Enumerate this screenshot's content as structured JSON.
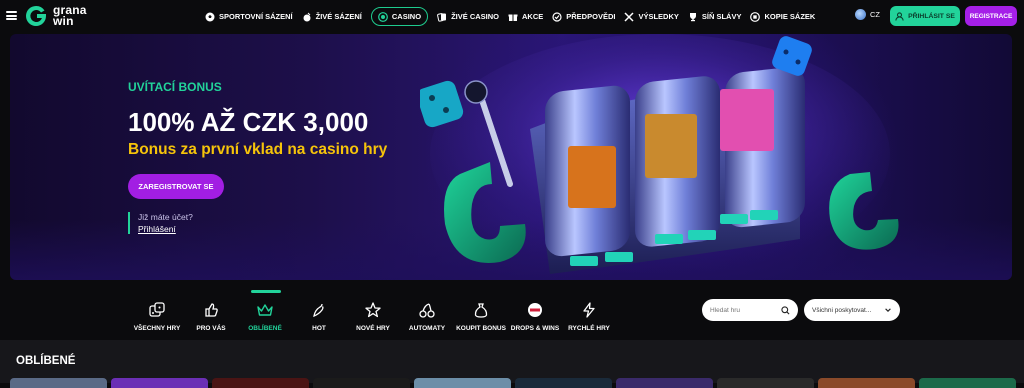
{
  "brand": {
    "line1": "grana",
    "line2": "win",
    "accent": "#22d39a",
    "purple": "#a51fe8",
    "yellow": "#f6c40a"
  },
  "nav": [
    {
      "label": "SPORTOVNÍ SÁZENÍ",
      "icon": "football-icon"
    },
    {
      "label": "ŽIVÉ SÁZENÍ",
      "icon": "live-ball-icon"
    },
    {
      "label": "CASINO",
      "icon": "casino-chip-icon",
      "active": true
    },
    {
      "label": "ŽIVÉ CASINO",
      "icon": "cards-icon"
    },
    {
      "label": "AKCE",
      "icon": "gift-icon"
    },
    {
      "label": "PŘEDPOVĚDI",
      "icon": "predictions-icon"
    },
    {
      "label": "VÝSLEDKY",
      "icon": "results-icon"
    },
    {
      "label": "SÍŇ SLÁVY",
      "icon": "trophy-icon"
    },
    {
      "label": "KOPIE SÁZEK",
      "icon": "copy-bets-icon"
    }
  ],
  "header": {
    "language": "CZ",
    "login_label": "PŘIHLÁSIT SE",
    "register_label": "REGISTRACE"
  },
  "hero": {
    "kicker": "UVÍTACÍ BONUS",
    "title": "100% AŽ CZK 3,000",
    "subtitle": "Bonus za první vklad na casino hry",
    "cta_label": "ZAREGISTROVAT SE",
    "account_question": "Již máte účet?",
    "account_link": "Přihlášení"
  },
  "categories": [
    {
      "label": "VŠECHNY HRY",
      "icon": "dice-icon"
    },
    {
      "label": "PRO VÁS",
      "icon": "thumbs-up-icon"
    },
    {
      "label": "OBLÍBENÉ",
      "icon": "crown-icon",
      "active": true
    },
    {
      "label": "HOT",
      "icon": "chili-icon"
    },
    {
      "label": "NOVÉ HRY",
      "icon": "star-icon"
    },
    {
      "label": "AUTOMATY",
      "icon": "cherries-icon"
    },
    {
      "label": "KOUPIT BONUS",
      "icon": "money-bag-icon"
    },
    {
      "label": "DROPS & WINS",
      "icon": "drops-wins-icon"
    },
    {
      "label": "RYCHLÉ HRY",
      "icon": "lightning-icon"
    }
  ],
  "search": {
    "placeholder": "Hledat hru"
  },
  "provider": {
    "selected": "Všichni poskytovat..."
  },
  "section": {
    "title": "OBLÍBENÉ"
  }
}
